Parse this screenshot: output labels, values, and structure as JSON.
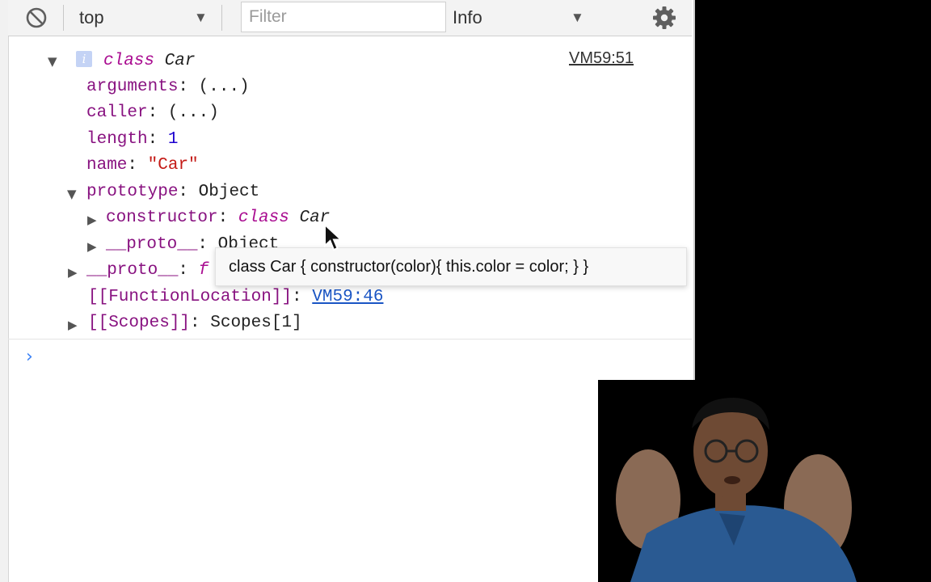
{
  "toolbar": {
    "context_label": "top",
    "filter_placeholder": "Filter",
    "level_label": "Info"
  },
  "console": {
    "log_source": "VM59:51",
    "header_keyword": "class",
    "header_name": "Car",
    "props": {
      "arguments_key": "arguments",
      "arguments_val": "(...)",
      "caller_key": "caller",
      "caller_val": "(...)",
      "length_key": "length",
      "length_val": "1",
      "name_key": "name",
      "name_val": "\"Car\"",
      "prototype_key": "prototype",
      "prototype_val": "Object",
      "constructor_key": "constructor",
      "constructor_kw": "class",
      "constructor_name": "Car",
      "proto_inner_key": "__proto__",
      "proto_inner_val": "Object",
      "proto_key": "__proto__",
      "proto_val": "f",
      "funcloc_key": "[[FunctionLocation]]",
      "funcloc_val": "VM59:46",
      "scopes_key": "[[Scopes]]",
      "scopes_val": "Scopes[1]"
    },
    "tooltip": "class Car { constructor(color){ this.color = color; } }",
    "prompt_glyph": "›"
  }
}
